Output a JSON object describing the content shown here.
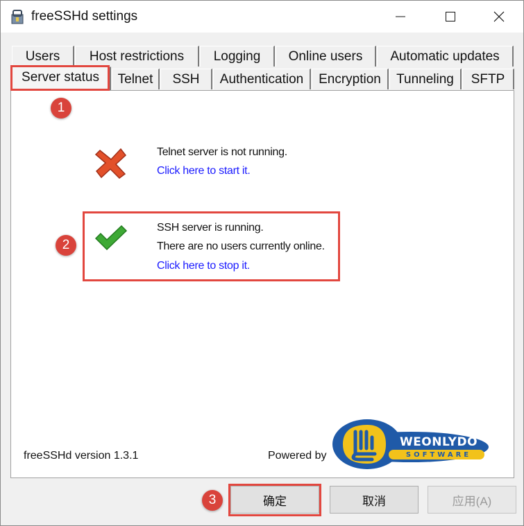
{
  "window": {
    "title": "freeSSHd settings"
  },
  "tabs_row1": [
    {
      "label": "Users"
    },
    {
      "label": "Host restrictions"
    },
    {
      "label": "Logging"
    },
    {
      "label": "Online users"
    },
    {
      "label": "Automatic updates"
    }
  ],
  "tabs_row2": [
    {
      "label": "Server status"
    },
    {
      "label": "Telnet"
    },
    {
      "label": "SSH"
    },
    {
      "label": "Authentication"
    },
    {
      "label": "Encryption"
    },
    {
      "label": "Tunneling"
    },
    {
      "label": "SFTP"
    }
  ],
  "telnet": {
    "status": "Telnet server is not running.",
    "action": "Click here to start it.",
    "icon": "red-x-icon"
  },
  "ssh": {
    "status": "SSH server is running.",
    "users": "There are no users currently online.",
    "action": "Click here to stop it.",
    "icon": "green-check-icon"
  },
  "footer": {
    "version": "freeSSHd version 1.3.1",
    "powered_by": "Powered by",
    "logo_text": "WEONLYDO",
    "logo_sub": "SOFTWARE"
  },
  "buttons": {
    "ok": "确定",
    "cancel": "取消",
    "apply": "应用(A)"
  },
  "annotations": [
    "1",
    "2",
    "3"
  ],
  "colors": {
    "highlight": "#e2473f",
    "link": "#1a1aff",
    "logo_blue": "#1f5aa8",
    "logo_yellow": "#f2c21b"
  }
}
